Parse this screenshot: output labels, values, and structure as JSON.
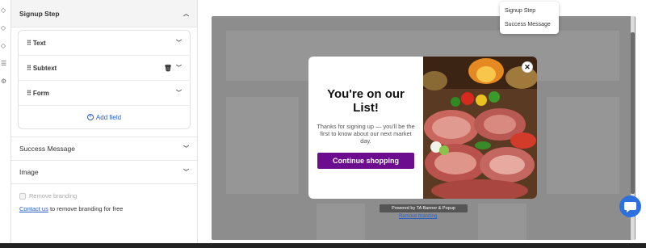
{
  "panel": {
    "signup_section": "Signup Step",
    "fields": [
      {
        "label": "Text"
      },
      {
        "label": "Subtext"
      },
      {
        "label": "Form"
      }
    ],
    "add_field": "Add field",
    "success_section": "Success Message",
    "image_section": "Image",
    "remove_branding": "Remove branding",
    "contact_link": "Contact us",
    "contact_rest": " to remove branding for free"
  },
  "menu": {
    "items": [
      "Signup Step",
      "Success Message"
    ]
  },
  "popup": {
    "title": "You're on our List!",
    "subtext": "Thanks for signing up — you'll be the first to know about our next market day.",
    "cta": "Continue shopping",
    "close": "✕"
  },
  "footer": {
    "powered": "Powered by TA Banner & Popup",
    "remove": "Remove branding"
  },
  "colors": {
    "accent": "#6b0d8e",
    "link": "#2a5fc9",
    "chat": "#2e6fe0"
  }
}
